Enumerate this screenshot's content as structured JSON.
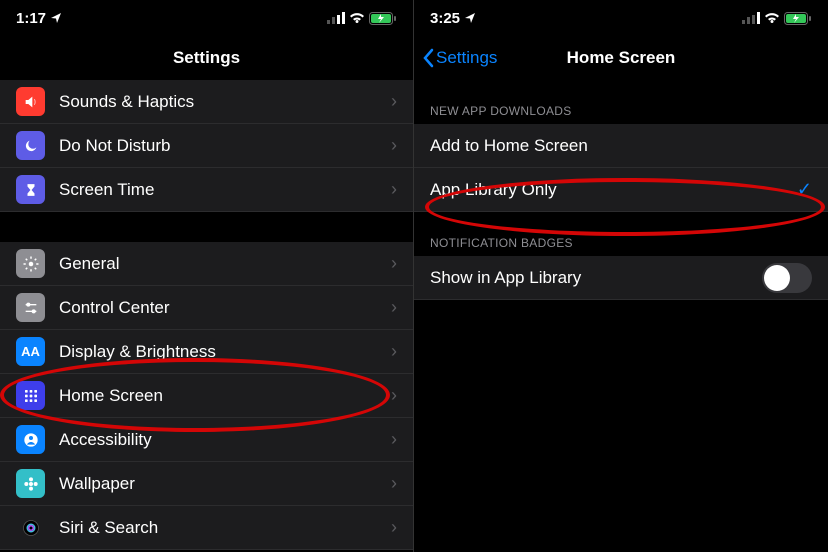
{
  "left": {
    "time": "1:17",
    "title": "Settings",
    "items": [
      {
        "label": "Sounds & Haptics",
        "bg": "#ff3b30",
        "glyph": "speaker"
      },
      {
        "label": "Do Not Disturb",
        "bg": "#5e5ce6",
        "glyph": "moon"
      },
      {
        "label": "Screen Time",
        "bg": "#5e5ce6",
        "glyph": "hourglass"
      }
    ],
    "items2": [
      {
        "label": "General",
        "bg": "#8e8e93",
        "glyph": "gear"
      },
      {
        "label": "Control Center",
        "bg": "#8e8e93",
        "glyph": "sliders"
      },
      {
        "label": "Display & Brightness",
        "bg": "#0a84ff",
        "glyph": "aa"
      },
      {
        "label": "Home Screen",
        "bg": "#3e3eeb",
        "glyph": "grid"
      },
      {
        "label": "Accessibility",
        "bg": "#0a84ff",
        "glyph": "person"
      },
      {
        "label": "Wallpaper",
        "bg": "#33bfc8",
        "glyph": "flower"
      },
      {
        "label": "Siri & Search",
        "bg": "#1c1c1e",
        "glyph": "siri"
      }
    ]
  },
  "right": {
    "time": "3:25",
    "back": "Settings",
    "title": "Home Screen",
    "section1_header": "NEW APP DOWNLOADS",
    "section1_rows": [
      {
        "label": "Add to Home Screen",
        "checked": false
      },
      {
        "label": "App Library Only",
        "checked": true
      }
    ],
    "section2_header": "NOTIFICATION BADGES",
    "section2_rows": [
      {
        "label": "Show in App Library",
        "toggle": false
      }
    ]
  }
}
